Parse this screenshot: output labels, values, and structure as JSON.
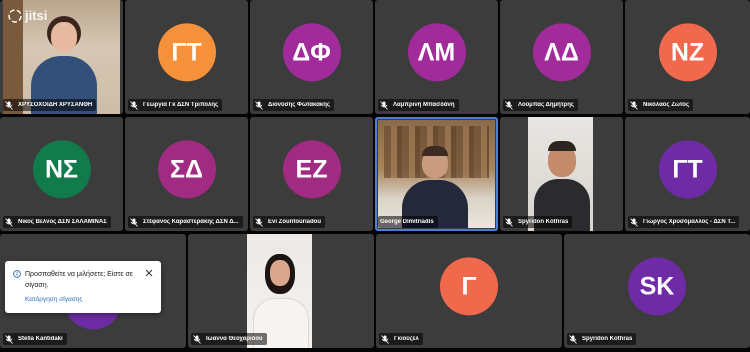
{
  "app": {
    "logo_text": "jitsi"
  },
  "tiles": [
    {
      "name": "ΧΡΥΣΟΧΟΪΔΗ ΧΡΥΣΑΝΘΗ",
      "type": "video"
    },
    {
      "name": "Γεωργια Γκ ΔΣΝ Τριπολης",
      "initials": "ΓΤ",
      "color": "#f6913b"
    },
    {
      "name": "Διονύσης Φωτακάκης",
      "initials": "ΔΦ",
      "color": "#a12b9a"
    },
    {
      "name": "Λαμπρινή Μπασδάνη",
      "initials": "ΛΜ",
      "color": "#a12b9a"
    },
    {
      "name": "Λούμπας Δημήτρης",
      "initials": "ΛΔ",
      "color": "#a12b9a"
    },
    {
      "name": "Νικόλαος Ζώτος",
      "initials": "ΝΖ",
      "color": "#f1694d"
    },
    {
      "name": "Νικος Βελνος ΔΣΝ ΣΑΛΑΜΙΝΑΣ",
      "initials": "ΝΣ",
      "color": "#127b4b"
    },
    {
      "name": "Στέφανος Καραστεράκης ΔΣΝ Δ...",
      "initials": "ΣΔ",
      "color": "#a12b82"
    },
    {
      "name": "Evi Zountouriadou",
      "initials": "ΕΖ",
      "color": "#a12b82"
    },
    {
      "name": "George Dimitriadis",
      "type": "video"
    },
    {
      "name": "Spyridon Kothras",
      "type": "video"
    },
    {
      "name": "Γιώργος Χρυσόμαλλος - ΔΣΝ Τ...",
      "initials": "ΓΤ",
      "color": "#6e2ba5"
    },
    {
      "name": "Stella Kantidaki",
      "type": "avatar-hidden"
    },
    {
      "name": "Ιωαννα Θεοχαριδου",
      "type": "video"
    },
    {
      "name": "Γκιούζελ",
      "initials": "Γ",
      "color": "#f1694d"
    },
    {
      "name": "Spyridon Kothras",
      "initials": "SK",
      "color": "#6e2ba5"
    }
  ],
  "notification": {
    "message": "Προσπαθείτε να μιλήσετε; Είστε σε σίγαση.",
    "action": "Κατάργηση σίγασης"
  }
}
